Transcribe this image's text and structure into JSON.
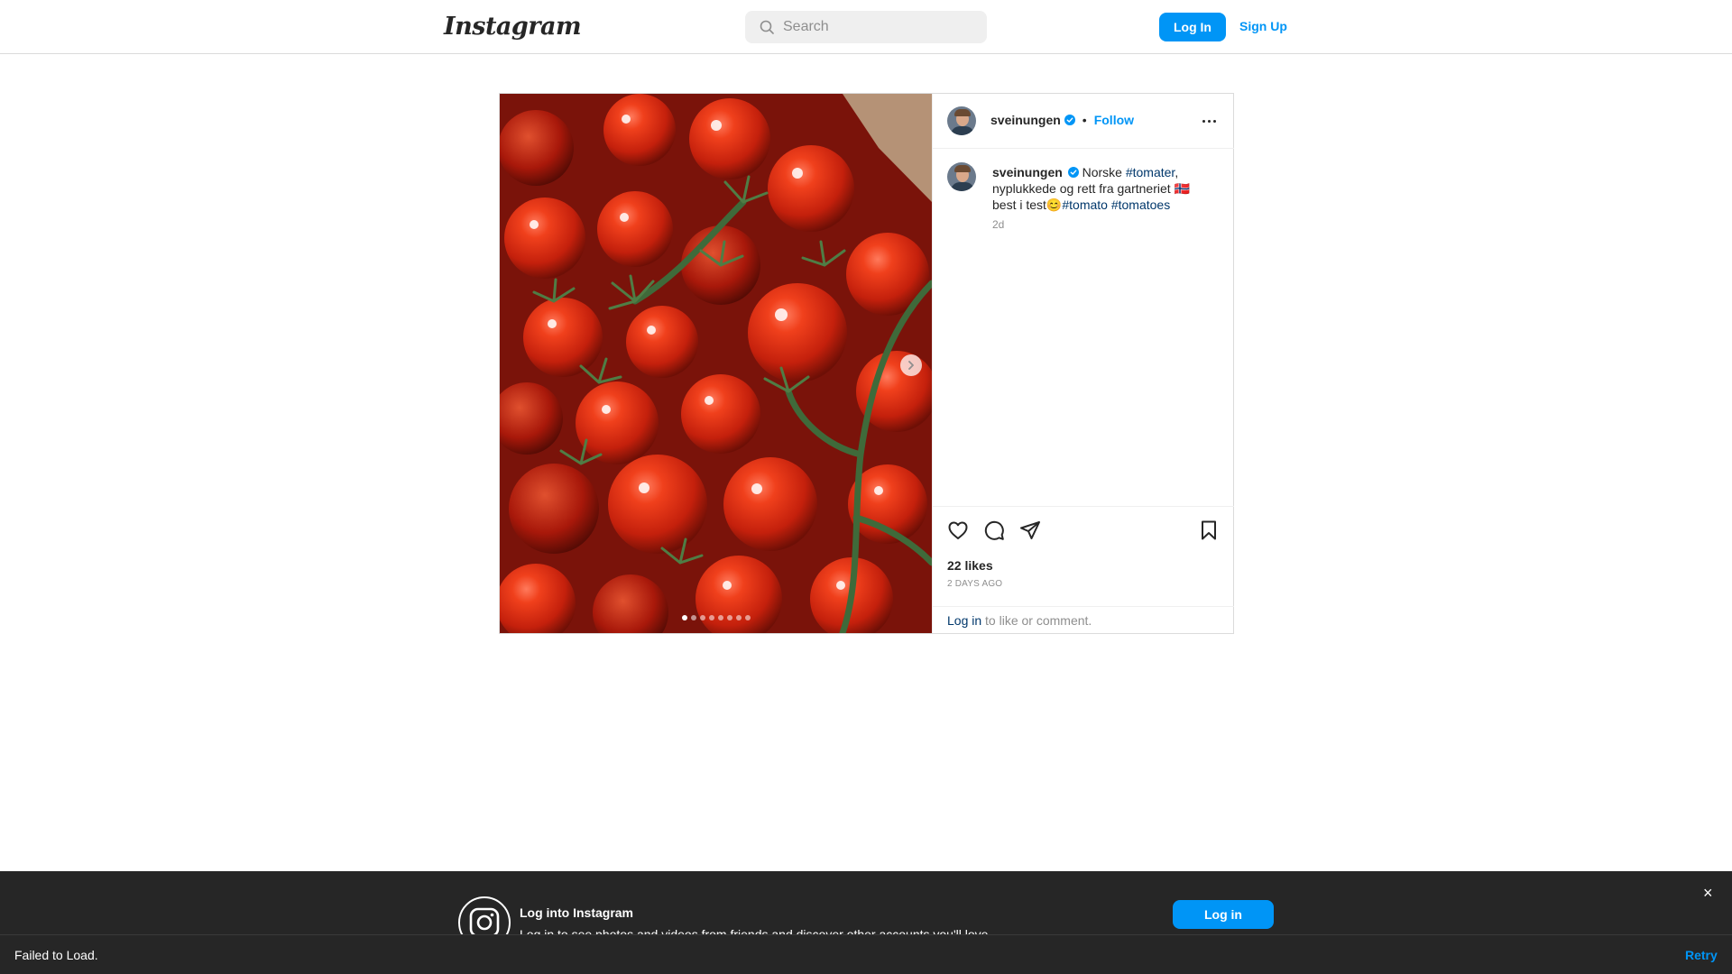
{
  "header": {
    "logo": "Instagram",
    "search_placeholder": "Search",
    "login_label": "Log In",
    "signup_label": "Sign Up"
  },
  "post": {
    "username": "sveinungen",
    "follow_label": "Follow",
    "separator": "•",
    "carousel": {
      "total_slides": 8,
      "active_slide": 1
    },
    "caption": {
      "username": "sveinungen",
      "text_1": "Norske",
      "tag_1": "#tomater",
      "text_2": ", nyplukkede og rett fra gartneriet 🇳🇴 best i test😊",
      "tag_2": "#tomato",
      "tag_3": "#tomatoes",
      "time": "2d"
    },
    "likes": "22 likes",
    "date": "2 DAYS AGO",
    "comment_login_link": "Log in",
    "comment_rest": " to like or comment."
  },
  "banner": {
    "title": "Log into Instagram",
    "subtitle": "Log in to see photos and videos from friends and discover other accounts you'll love.",
    "button_label": "Log in",
    "close_label": "×"
  },
  "snackbar": {
    "message": "Failed to Load.",
    "retry_label": "Retry"
  },
  "colors": {
    "accent": "#0095f6",
    "hashtag": "#00376b",
    "banner_bg": "#262626"
  }
}
